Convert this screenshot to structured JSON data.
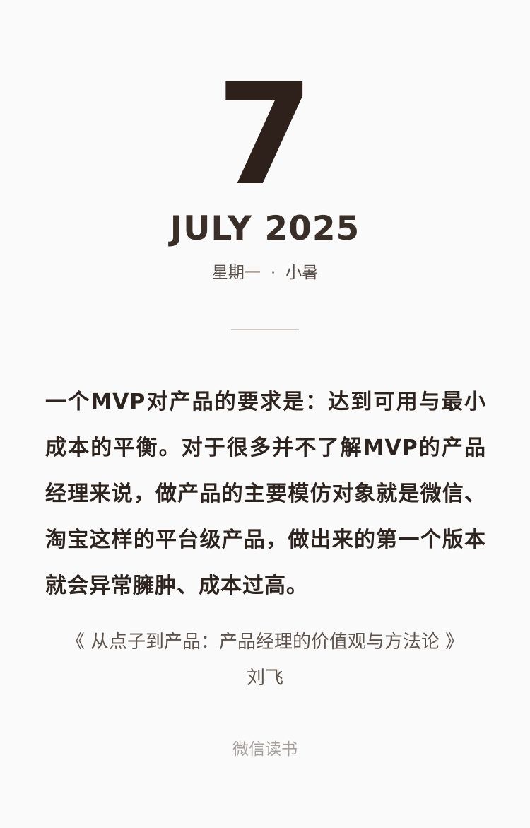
{
  "date": {
    "day": "7",
    "month_year": "JULY 2025",
    "weekday": "星期一",
    "separator": "·",
    "solar_term": "小暑"
  },
  "quote": {
    "text": "一个MVP对产品的要求是：达到可用与最小成本的平衡。对于很多并不了解MVP的产品经理来说，做产品的主要模仿对象就是微信、淘宝这样的平台级产品，做出来的第一个版本就会异常臃肿、成本过高。"
  },
  "source": {
    "book": "《 从点子到产品：产品经理的价值观与方法论 》",
    "author": "刘飞"
  },
  "footer": {
    "brand": "微信读书"
  },
  "colors": {
    "background": "#fafafa",
    "primary_text": "#2e241f",
    "secondary_text": "#5e524c",
    "muted_text": "#a8a19d",
    "divider": "#cfc9c6"
  }
}
